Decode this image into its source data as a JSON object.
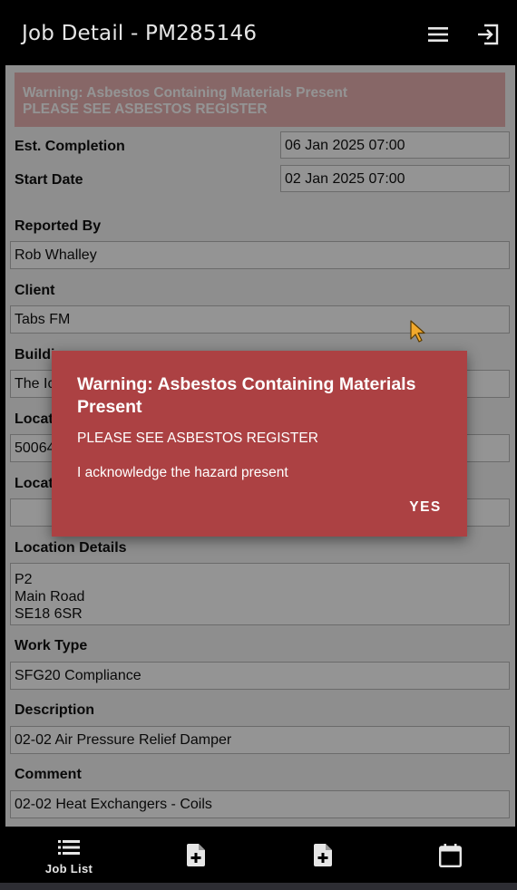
{
  "header": {
    "title": "Job Detail - PM285146",
    "menu_icon": "hamburger-menu-icon",
    "exit_icon": "logout-icon"
  },
  "banner": {
    "line1": "Warning: Asbestos Containing Materials Present",
    "line2": "PLEASE SEE ASBESTOS REGISTER"
  },
  "est_completion": {
    "label": "Est. Completion",
    "value": "06 Jan 2025 07:00"
  },
  "start_date": {
    "label": "Start Date",
    "value": "02 Jan 2025 07:00"
  },
  "fields": {
    "reported_by": {
      "label": "Reported By",
      "value": "Rob Whalley"
    },
    "client": {
      "label": "Client",
      "value": "Tabs FM"
    },
    "building": {
      "label": "Buildi",
      "value": "The Ic"
    },
    "location": {
      "label": "Locati",
      "value": "50064"
    },
    "location2": {
      "label": "Locati",
      "value": ""
    },
    "location_details": {
      "label": "Location Details",
      "lines": [
        "P2",
        "Main Road",
        "SE18 6SR"
      ]
    },
    "work_type": {
      "label": "Work Type",
      "value": "SFG20 Compliance"
    },
    "description": {
      "label": "Description",
      "value": "02-02 Air Pressure Relief Damper"
    },
    "comment": {
      "label": "Comment",
      "value": "02-02 Heat Exchangers - Coils"
    }
  },
  "dialog": {
    "title": "Warning: Asbestos Containing Materials Present",
    "message": "PLEASE SEE ASBESTOS REGISTER",
    "acknowledge": "I acknowledge the hazard present",
    "yes_label": "YES"
  },
  "bottom_nav": {
    "items": [
      {
        "label": "Job List",
        "icon": "list-icon"
      },
      {
        "label": "",
        "icon": "new-document-icon"
      },
      {
        "label": "",
        "icon": "new-document-icon"
      },
      {
        "label": "",
        "icon": "calendar-icon"
      }
    ]
  },
  "colors": {
    "header_bg": "#000000",
    "dialog_bg": "#ac4143",
    "banner_bg": "#e8b2b2",
    "cursor": "#f2a92c"
  }
}
